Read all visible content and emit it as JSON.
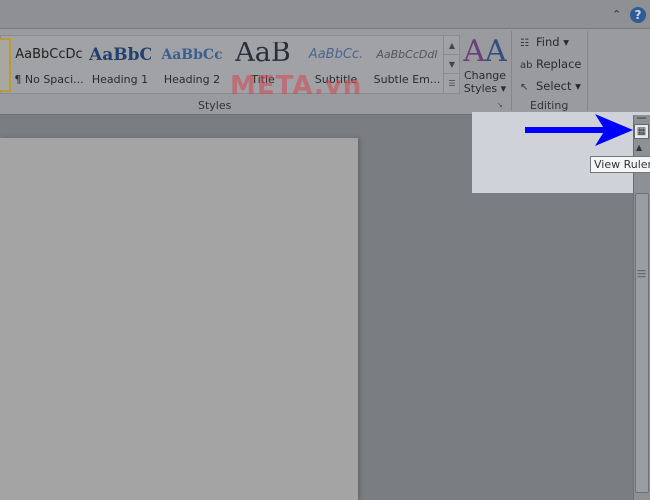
{
  "topbar": {
    "minimize_icon": "ribbon-minimize-icon",
    "help": "?"
  },
  "styles": {
    "items": [
      {
        "preview": "AaBbCcDc",
        "label": "¶ No Spaci..."
      },
      {
        "preview": "AaBbC",
        "label": "Heading 1"
      },
      {
        "preview": "AaBbCc",
        "label": "Heading 2"
      },
      {
        "preview": "AaB",
        "label": "Title"
      },
      {
        "preview": "AaBbCc.",
        "label": "Subtitle"
      },
      {
        "preview": "AaBbCcDdI",
        "label": "Subtle Em..."
      }
    ],
    "group_label": "Styles",
    "change_styles": "Change",
    "change_styles2": "Styles ▾"
  },
  "editing": {
    "find": "Find ▾",
    "replace": "Replace",
    "select": "Select ▾",
    "group_label": "Editing"
  },
  "watermark": "META.vn",
  "tooltip": "View Ruler",
  "colors": {
    "arrow": "#0000ff",
    "highlight": "#cfd2d8"
  }
}
